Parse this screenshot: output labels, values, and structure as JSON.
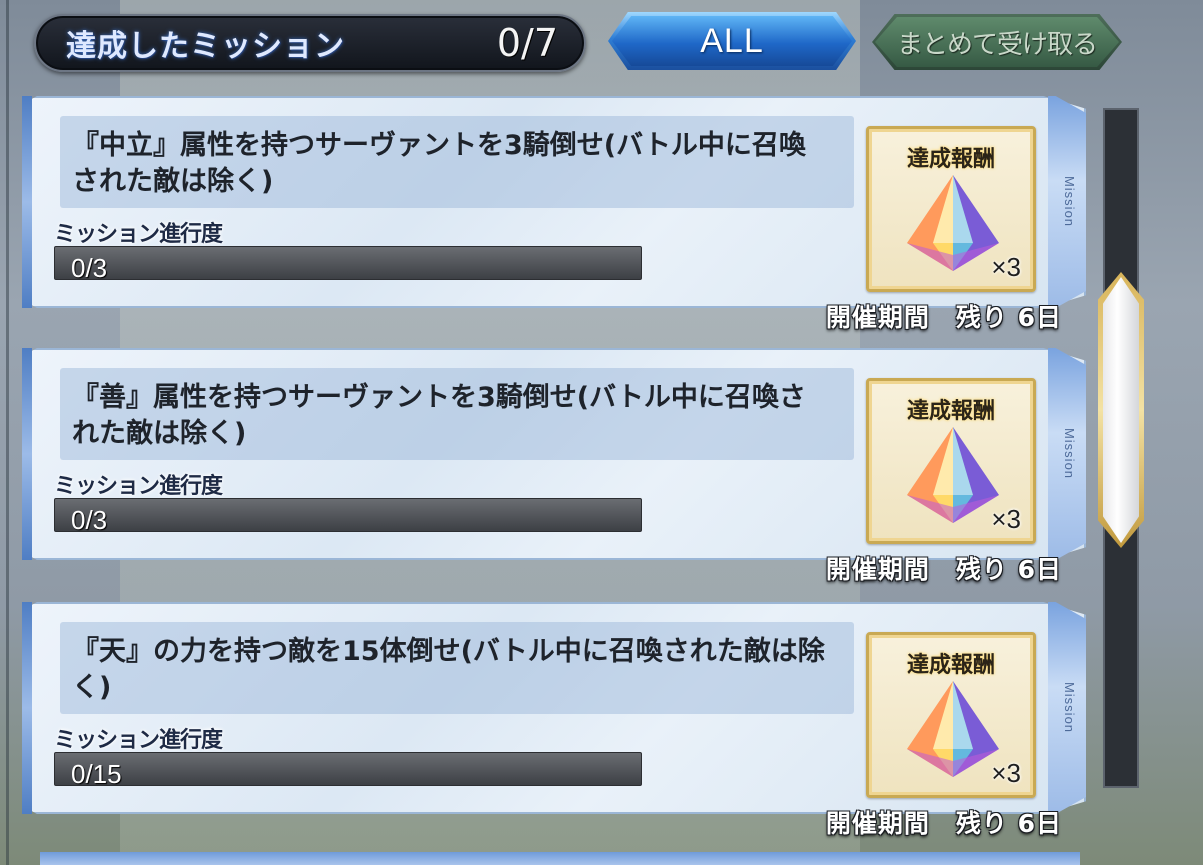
{
  "header": {
    "title": "達成したミッション",
    "count": "0/7",
    "filter_label": "ALL",
    "collect_all_label": "まとめて受け取る"
  },
  "missions": [
    {
      "description": "『中立』属性を持つサーヴァントを3騎倒せ(バトル中に召喚された敵は除く)",
      "progress_label": "ミッション進行度",
      "progress_text": "0/3",
      "progress_fraction": 0,
      "reward_label": "達成報酬",
      "reward_icon": "saint-quartz-icon",
      "reward_qty": "×3",
      "side_tag": "Mission",
      "period": "開催期間　残り 6日"
    },
    {
      "description": "『善』属性を持つサーヴァントを3騎倒せ(バトル中に召喚された敵は除く)",
      "progress_label": "ミッション進行度",
      "progress_text": "0/3",
      "progress_fraction": 0,
      "reward_label": "達成報酬",
      "reward_icon": "saint-quartz-icon",
      "reward_qty": "×3",
      "side_tag": "Mission",
      "period": "開催期間　残り 6日"
    },
    {
      "description": "『天』の力を持つ敵を15体倒せ(バトル中に召喚された敵は除く)",
      "progress_label": "ミッション進行度",
      "progress_text": "0/15",
      "progress_fraction": 0,
      "reward_label": "達成報酬",
      "reward_icon": "saint-quartz-icon",
      "reward_qty": "×3",
      "side_tag": "Mission",
      "period": "開催期間　残り 6日"
    }
  ],
  "colors": {
    "filter_button": "#1f68c8",
    "collect_button": "#365a44",
    "card_accent": "#7aa3df",
    "reward_frame": "#c9a953"
  }
}
